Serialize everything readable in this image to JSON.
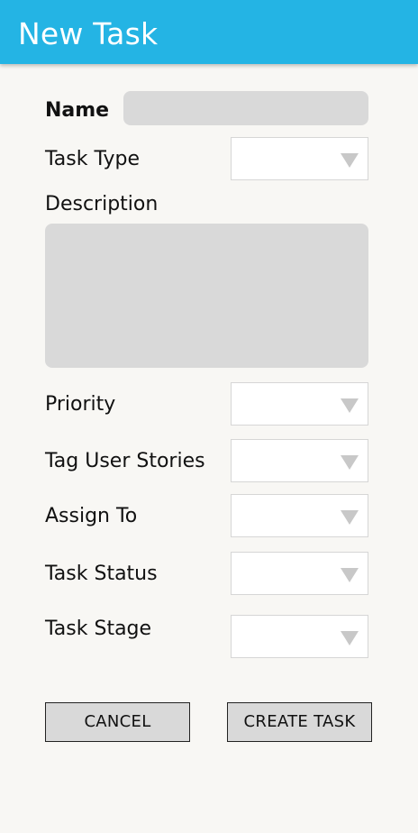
{
  "header": {
    "title": "New Task",
    "background_color": "#24b4e4"
  },
  "form": {
    "name": {
      "label": "Name",
      "value": "",
      "placeholder": ""
    },
    "task_type": {
      "label": "Task Type",
      "selected": ""
    },
    "description": {
      "label": "Description",
      "value": "",
      "placeholder": ""
    },
    "priority": {
      "label": "Priority",
      "selected": ""
    },
    "tag_user_stories": {
      "label": "Tag User Stories",
      "selected": ""
    },
    "assign_to": {
      "label": "Assign To",
      "selected": ""
    },
    "task_status": {
      "label": "Task Status",
      "selected": ""
    },
    "task_stage": {
      "label": "Task Stage",
      "selected": ""
    }
  },
  "actions": {
    "cancel_label": "CANCEL",
    "create_label": "CREATE TASK"
  },
  "icons": {
    "dropdown": "chevron-down-icon"
  }
}
